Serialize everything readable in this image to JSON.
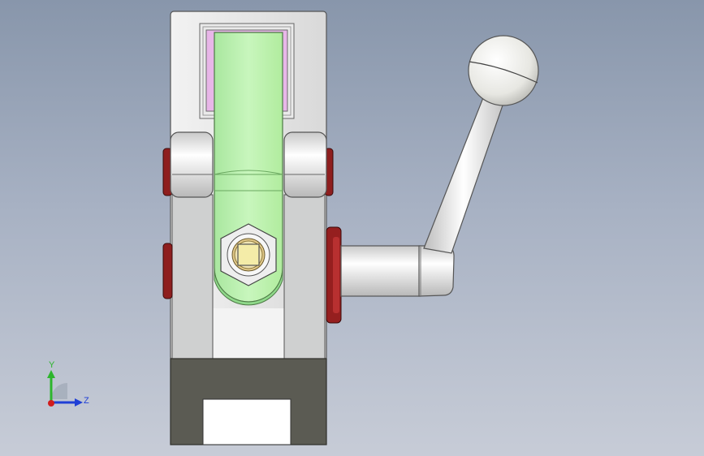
{
  "viewport": {
    "background_top": "#8896ab",
    "background_bottom": "#c7ccd7"
  },
  "triad": {
    "x_label": "",
    "y_label": "Y",
    "z_label": "Z",
    "y_color": "#2db52d",
    "z_color": "#1f3fd6",
    "x_color": "#d11d1d"
  },
  "model": {
    "colors": {
      "body": "#e4e4e4",
      "body_shadow": "#bfc0c0",
      "base": "#5a5a52",
      "link": "#bff2b0",
      "link_shadow": "#8fd98a",
      "window": "#e8b6e8",
      "seal": "#8f1d1d",
      "handle": "#f1f1ee",
      "nut": "#e9e9e9",
      "bolt_square": "#f2e9a8"
    },
    "parts": [
      "clamp-body",
      "base-block",
      "linkage-arm",
      "pivot-pin",
      "hex-nut",
      "lever-handle",
      "ball-knob"
    ]
  }
}
